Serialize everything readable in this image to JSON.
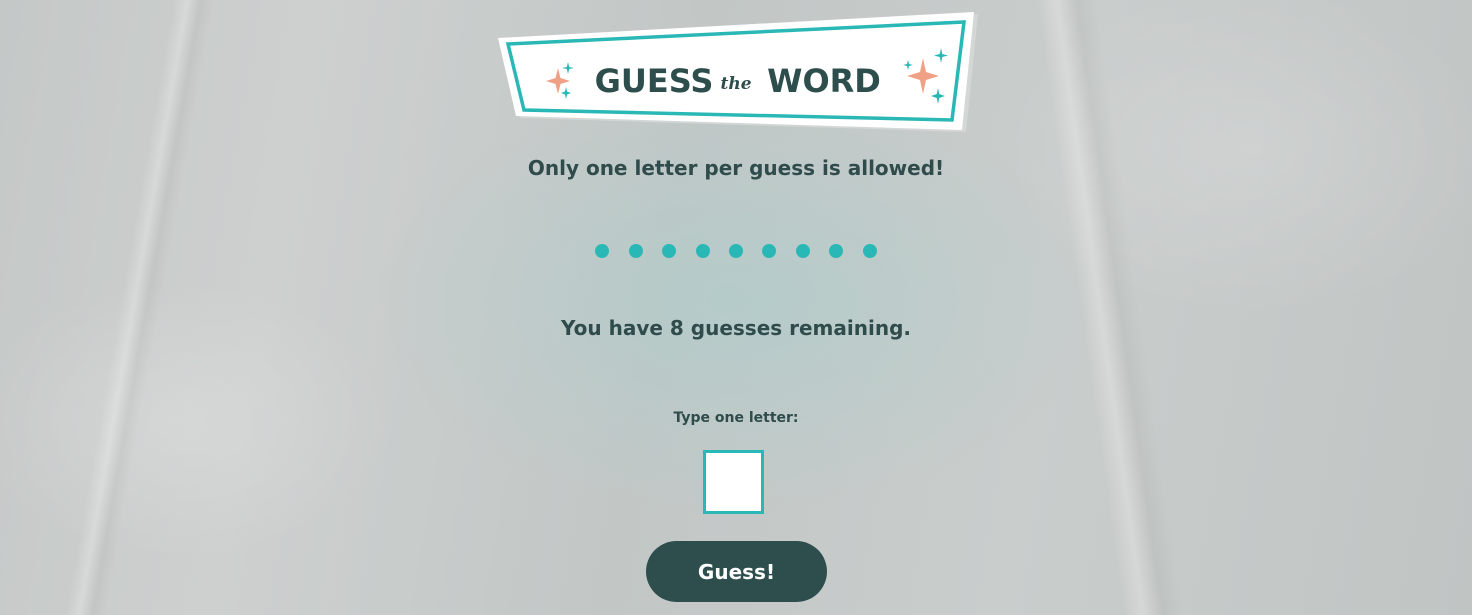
{
  "logo": {
    "word_left": "GUESS",
    "word_mid": "the",
    "word_right": "WORD"
  },
  "messages": {
    "top": "Only one letter per guess is allowed!",
    "remaining": "You have 8 guesses remaining."
  },
  "word_in_progress": {
    "placeholder_count": 9,
    "placeholder_symbol": "●"
  },
  "guess_form": {
    "label": "Type one letter:",
    "input_value": "",
    "button_label": "Guess!"
  },
  "colors": {
    "accent_teal": "#2ab8b6",
    "dark_slate": "#2e4d4d",
    "text": "#2f4b4b",
    "sparkle_orange": "#f0a085"
  }
}
